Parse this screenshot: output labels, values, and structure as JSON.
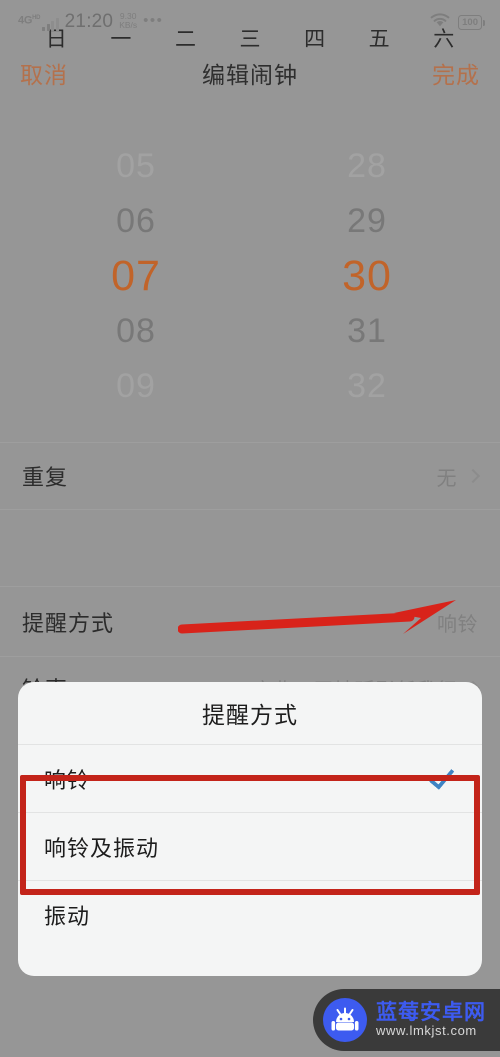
{
  "status_bar": {
    "network_type": "4G",
    "network_sup": "HD",
    "time": "21:20",
    "speed_value": "9.30",
    "speed_unit": "KB/s",
    "overflow_dots": "•••",
    "wifi_icon": "wifi-icon",
    "battery_level": "100"
  },
  "nav_bar": {
    "cancel_label": "取消",
    "title": "编辑闹钟",
    "done_label": "完成"
  },
  "time_picker": {
    "hours": [
      "05",
      "06",
      "07",
      "08",
      "09"
    ],
    "minutes": [
      "28",
      "29",
      "30",
      "31",
      "32"
    ],
    "selected_hour": "07",
    "selected_minute": "30",
    "selected_hour_index": 2,
    "selected_minute_index": 2
  },
  "rows": {
    "repeat": {
      "label": "重复",
      "value": "无"
    },
    "weekdays": [
      "日",
      "一",
      "二",
      "三",
      "四",
      "五",
      "六"
    ],
    "reminder": {
      "label": "提醒方式",
      "value": "响铃"
    },
    "ringtone": {
      "label": "铃声",
      "value": "序曲：天地孤影任我行"
    }
  },
  "dialog": {
    "title": "提醒方式",
    "options": [
      {
        "label": "响铃",
        "checked": true
      },
      {
        "label": "响铃及振动",
        "checked": false
      },
      {
        "label": "振动",
        "checked": false
      }
    ]
  },
  "annotations": {
    "arrow_color": "#d8231a",
    "box_color": "#c3241a"
  },
  "watermark": {
    "title": "蓝莓安卓网",
    "url": "www.lmkjst.com",
    "logo_icon": "android-robot-icon"
  },
  "colors": {
    "background_dim": "#969696",
    "accent_orange": "#b4714c",
    "selected_orange": "#c1642a",
    "check_blue": "#3f84c4",
    "dialog_bg": "#f4f5f5"
  }
}
